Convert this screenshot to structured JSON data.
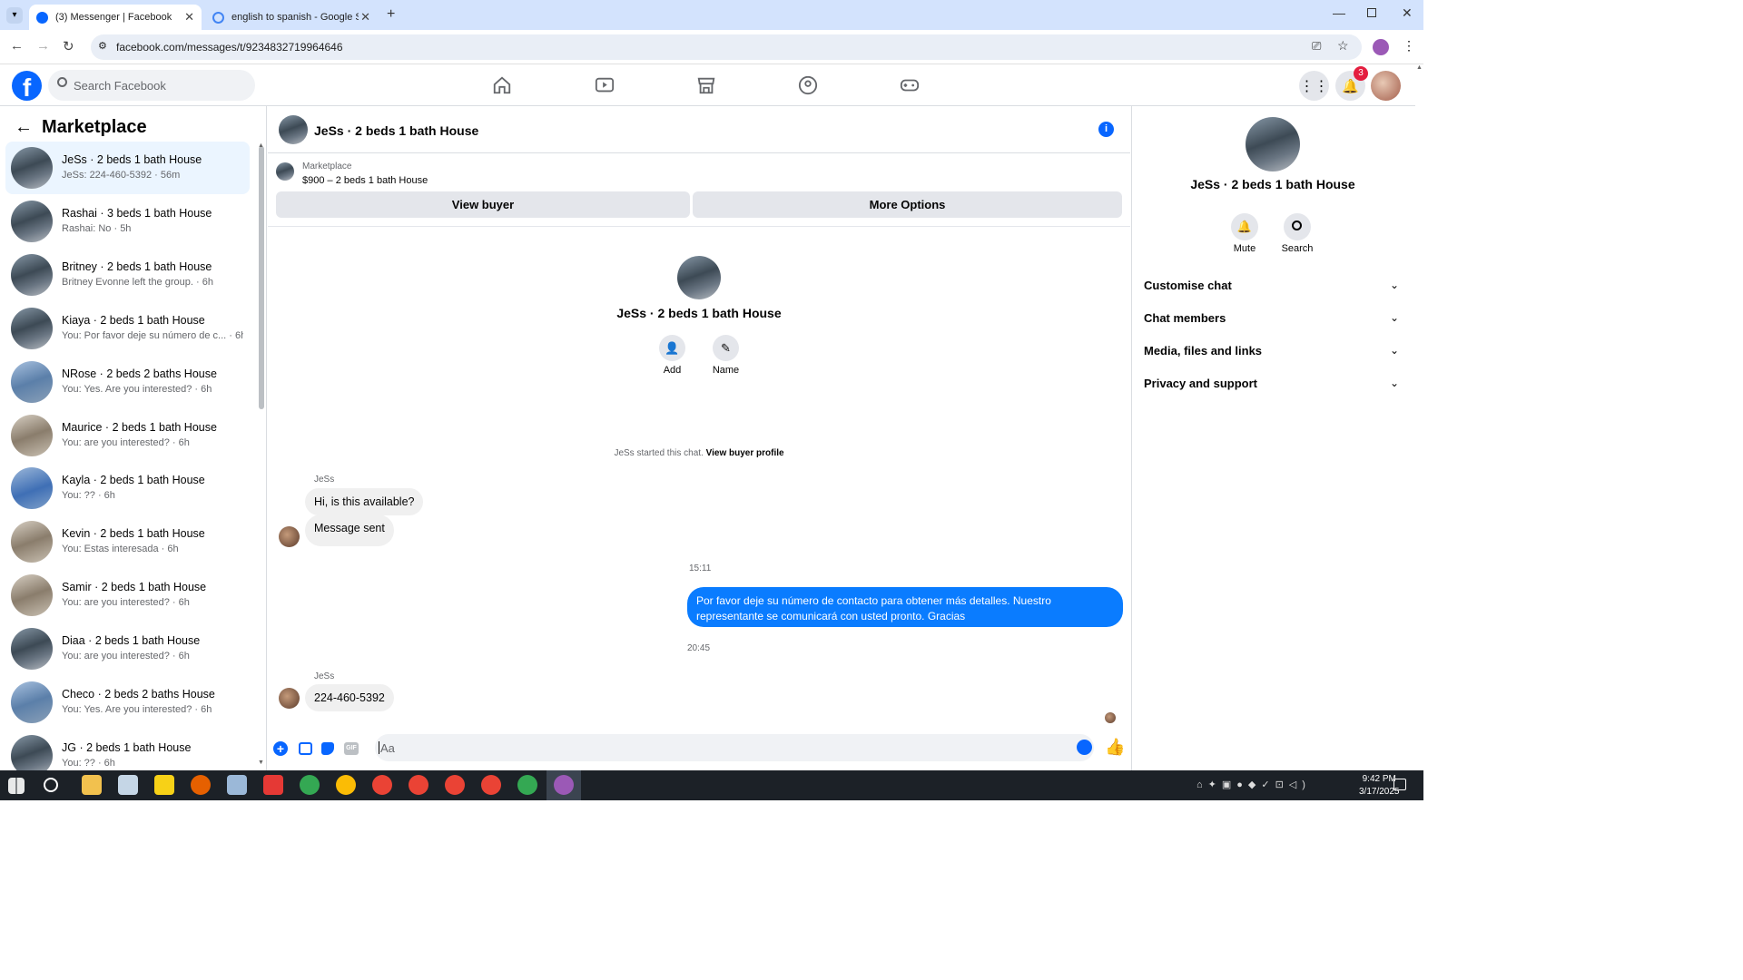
{
  "browser": {
    "tabs": [
      {
        "title": "(3) Messenger | Facebook",
        "active": true
      },
      {
        "title": "english to spanish - Google Sea",
        "active": false
      }
    ],
    "url": "facebook.com/messages/t/9234832719964646"
  },
  "fb_header": {
    "search_placeholder": "Search Facebook",
    "notification_count": "3",
    "nav_icons": [
      "home-icon",
      "video-icon",
      "marketplace-icon",
      "groups-icon",
      "gaming-icon"
    ]
  },
  "sidebar": {
    "title": "Marketplace",
    "conversations": [
      {
        "title": "JeSs · 2 beds 1 bath House",
        "snippet": "JeSs: 224-460-5392 · 56m",
        "selected": true
      },
      {
        "title": "Rashai · 3 beds 1 bath House",
        "snippet": "Rashai: No · 5h"
      },
      {
        "title": "Britney · 2 beds 1 bath House",
        "snippet": "Britney Evonne left the group. · 6h"
      },
      {
        "title": "Kiaya · 2 beds 1 bath House",
        "snippet": "You: Por favor deje su número de c... · 6h"
      },
      {
        "title": "NRose · 2 beds 2 baths House",
        "snippet": "You: Yes. Are you interested? · 6h"
      },
      {
        "title": "Maurice · 2 beds 1 bath House",
        "snippet": "You: are you interested? · 6h"
      },
      {
        "title": "Kayla · 2 beds 1 bath House",
        "snippet": "You: ?? · 6h"
      },
      {
        "title": "Kevin · 2 beds 1 bath House",
        "snippet": "You: Estas interesada · 6h"
      },
      {
        "title": "Samir · 2 beds 1 bath House",
        "snippet": "You: are you interested? · 6h"
      },
      {
        "title": "Diaa · 2 beds 1 bath House",
        "snippet": "You: are you interested? · 6h"
      },
      {
        "title": "Checo · 2 beds 2 baths House",
        "snippet": "You: Yes. Are you interested? · 6h"
      },
      {
        "title": "JG · 2 beds 1 bath House",
        "snippet": "You: ?? · 6h"
      }
    ]
  },
  "chat": {
    "title": "JeSs · 2 beds 1 bath House",
    "listing_source": "Marketplace",
    "listing_title": "$900 – 2 beds 1 bath House",
    "view_buyer": "View buyer",
    "more_options": "More Options",
    "profile_name": "JeSs · 2 beds 1 bath House",
    "add_label": "Add",
    "name_label": "Name",
    "started_text": "JeSs started this chat.",
    "view_buyer_profile": "View buyer profile",
    "sender1": "JeSs",
    "msg1": "Hi, is this available?",
    "msg2": "Message sent",
    "time1": "15:11",
    "msg3": "Por favor deje su número de contacto para obtener más detalles. Nuestro representante se comunicará con usted pronto. Gracias",
    "time2": "20:45",
    "sender2": "JeSs",
    "msg4": "224-460-5392",
    "composer_placeholder": "Aa"
  },
  "right_panel": {
    "name": "JeSs · 2 beds 1 bath House",
    "mute": "Mute",
    "search": "Search",
    "sections": [
      "Customise chat",
      "Chat members",
      "Media, files and links",
      "Privacy and support"
    ]
  },
  "taskbar": {
    "time": "9:42 PM",
    "date": "3/17/2025"
  },
  "colors": {
    "fb_blue": "#0866ff",
    "bubble_out": "#0a7cff",
    "selected_bg": "#ebf5ff"
  }
}
